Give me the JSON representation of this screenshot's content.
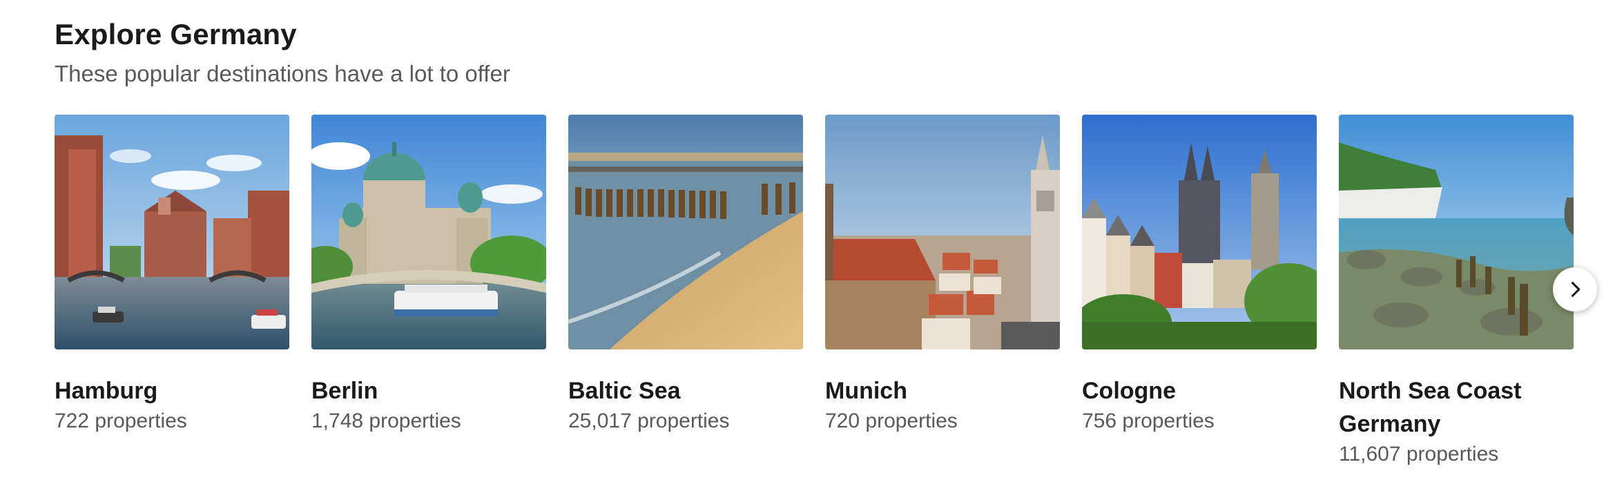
{
  "section": {
    "title": "Explore Germany",
    "subtitle": "These popular destinations have a lot to offer"
  },
  "destinations": [
    {
      "name": "Hamburg",
      "count": "722 properties",
      "image": "Hamburg canal with red-brick warehouses and boats"
    },
    {
      "name": "Berlin",
      "count": "1,748 properties",
      "image": "Berlin Cathedral dome and bridge over the Spree with tour boat"
    },
    {
      "name": "Baltic Sea",
      "count": "25,017 properties",
      "image": "Wooden groynes on a sandy Baltic beach"
    },
    {
      "name": "Munich",
      "count": "720 properties",
      "image": "Munich rooftops with church spires"
    },
    {
      "name": "Cologne",
      "count": "756 properties",
      "image": "Cologne skyline with cathedral twin spires"
    },
    {
      "name": "North Sea Coast Germany",
      "count": "11,607 properties",
      "image": "Rocky coast with chalk cliffs and wooden posts"
    }
  ],
  "carousel": {
    "next_icon": "chevron-right-icon"
  },
  "colors": {
    "heading": "#1a1a1a",
    "muted": "#595959",
    "sky": "#5b9fd8",
    "brick": "#a9533a"
  }
}
